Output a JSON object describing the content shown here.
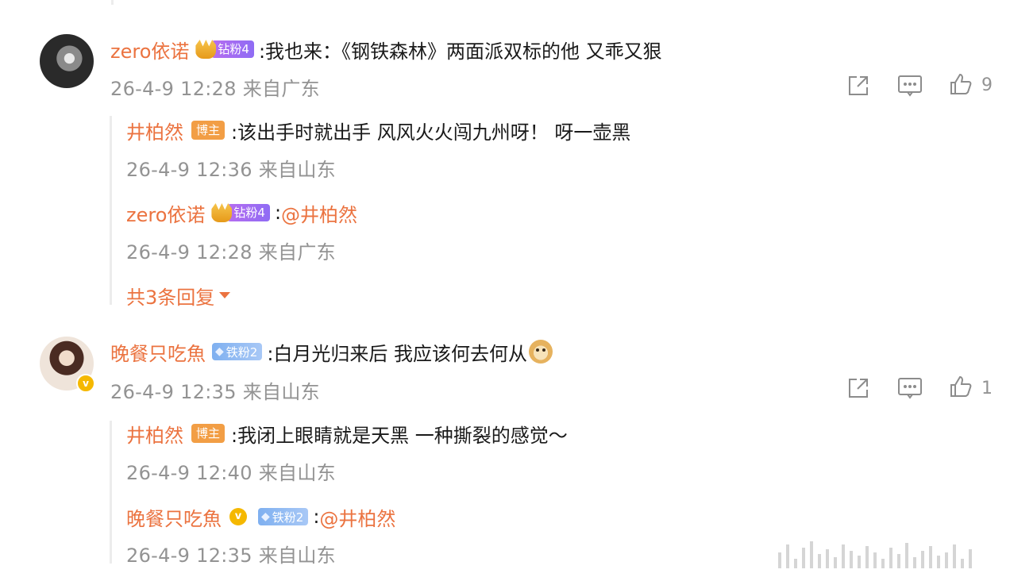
{
  "top_cutoff": "...",
  "comments": [
    {
      "username": "zero依诺",
      "badge": "钻粉4",
      "text": ":我也来：《钢铁森林》两面派双标的他  又乖又狠",
      "meta": "26-4-9 12:28 来自广东",
      "likes": "9",
      "replies": [
        {
          "username": "井柏然",
          "host_badge": "博主",
          "text": ":该出手时就出手 风风火火闯九州呀！ 呀一壶黑",
          "meta": "26-4-9 12:36 来自山东"
        },
        {
          "username": "zero依诺",
          "badge": "钻粉4",
          "text": ":",
          "mention": "@井柏然",
          "meta": "26-4-9 12:28 来自广东"
        }
      ],
      "more_replies": "共3条回复"
    },
    {
      "username": "晚餐只吃魚",
      "badge": "铁粉2",
      "verified": "v",
      "text": ":白月光归来后 我应该何去何从",
      "meta": "26-4-9 12:35 来自山东",
      "likes": "1",
      "replies": [
        {
          "username": "井柏然",
          "host_badge": "博主",
          "text": ":我闭上眼睛就是天黑 一种撕裂的感觉～",
          "meta": "26-4-9 12:40 来自山东"
        },
        {
          "username": "晚餐只吃魚",
          "verified": "v",
          "badge": "铁粉2",
          "text": ":",
          "mention": "@井柏然",
          "meta": "26-4-9 12:35 来自山东"
        }
      ]
    }
  ],
  "icons": [
    "share-icon",
    "comment-icon",
    "like-icon",
    "crown-icon",
    "diamond-icon",
    "doge-emoji-icon"
  ],
  "colors": {
    "username": "#eb7340",
    "meta": "#939393",
    "host_badge": "#f29e45",
    "diamond_badge": "#9b6cf2",
    "iron_badge": "#8bb7f2",
    "verified": "#f5b800"
  }
}
